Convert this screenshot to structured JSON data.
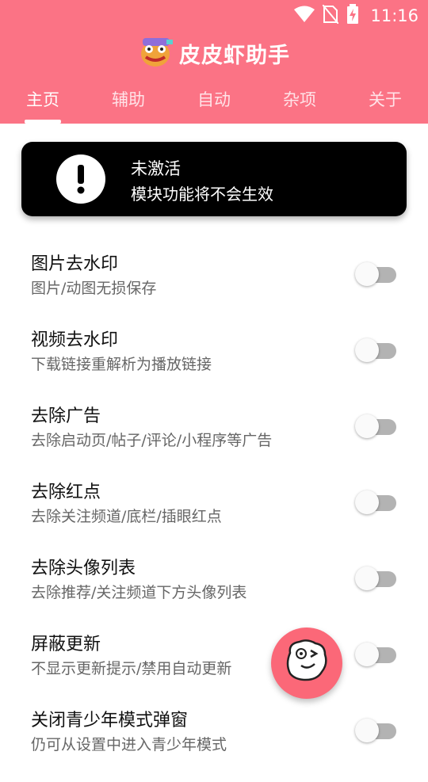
{
  "status_bar": {
    "time": "11:16",
    "icons": [
      "wifi-icon",
      "no-sim-icon",
      "battery-charging-icon"
    ]
  },
  "app": {
    "title": "皮皮虾助手",
    "logo": "app-logo-icon"
  },
  "tabs": [
    {
      "label": "主页",
      "active": true
    },
    {
      "label": "辅助",
      "active": false
    },
    {
      "label": "自动",
      "active": false
    },
    {
      "label": "杂项",
      "active": false
    },
    {
      "label": "关于",
      "active": false
    }
  ],
  "notice": {
    "icon": "exclamation-icon",
    "title": "未激活",
    "subtitle": "模块功能将不会生效"
  },
  "settings": [
    {
      "title": "图片去水印",
      "desc": "图片/动图无损保存",
      "enabled": false
    },
    {
      "title": "视频去水印",
      "desc": "下载链接重解析为播放链接",
      "enabled": false
    },
    {
      "title": "去除广告",
      "desc": "去除启动页/帖子/评论/小程序等广告",
      "enabled": false
    },
    {
      "title": "去除红点",
      "desc": "去除关注频道/底栏/插眼红点",
      "enabled": false
    },
    {
      "title": "去除头像列表",
      "desc": "去除推荐/关注频道下方头像列表",
      "enabled": false
    },
    {
      "title": "屏蔽更新",
      "desc": "不显示更新提示/禁用自动更新",
      "enabled": false
    },
    {
      "title": "关闭青少年模式弹窗",
      "desc": "仍可从设置中进入青少年模式",
      "enabled": false
    }
  ],
  "fab": {
    "icon": "shrimp-face-icon"
  },
  "colors": {
    "accent": "#fb7385",
    "fab": "#fb6878",
    "notice_bg": "#000000"
  }
}
